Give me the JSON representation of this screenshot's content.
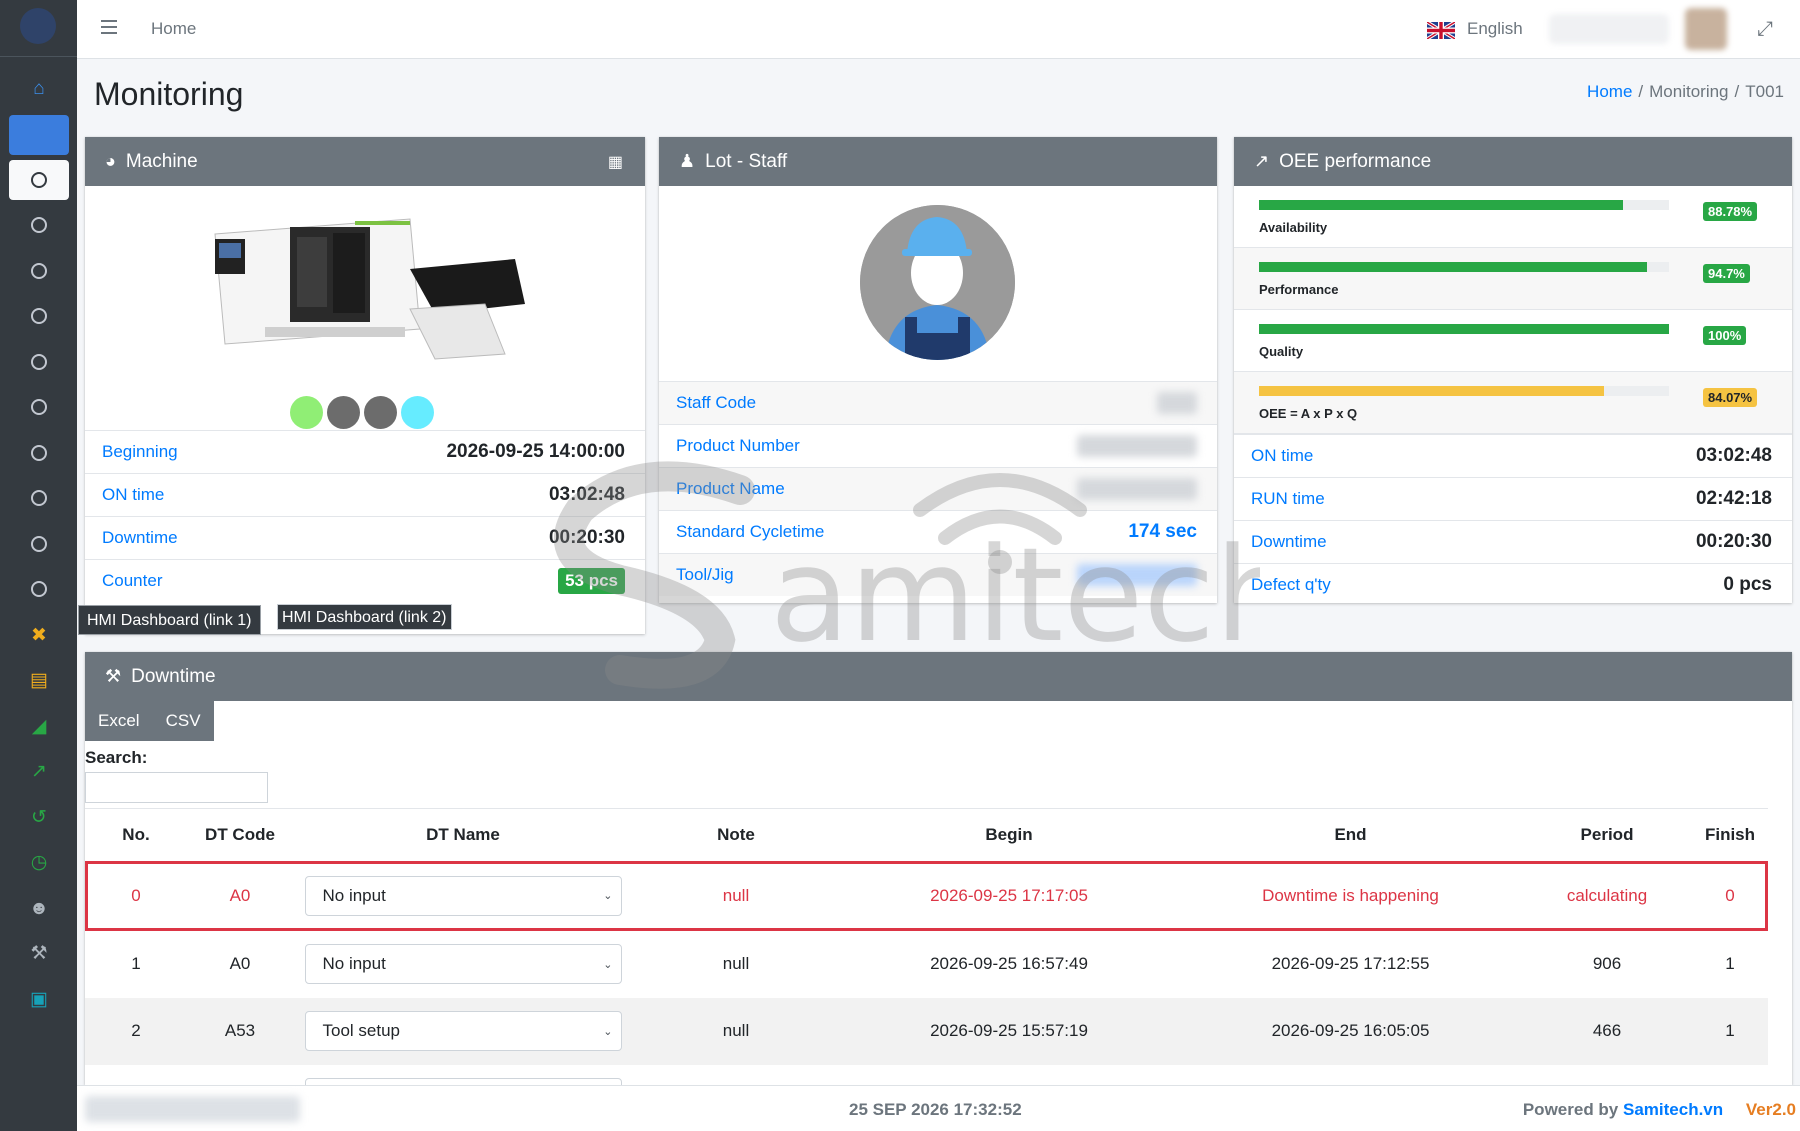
{
  "navbar": {
    "home": "Home",
    "language": "English"
  },
  "page": {
    "title": "Monitoring",
    "breadcrumb": [
      "Home",
      "Monitoring",
      "T001"
    ]
  },
  "machine": {
    "title": "Machine",
    "status_colors": [
      "#90ee75",
      "#6c6c6c",
      "#6c6c6c",
      "#66ecff"
    ],
    "rows": [
      {
        "label": "Beginning",
        "value": "2026-09-25 14:00:00"
      },
      {
        "label": "ON time",
        "value": "03:02:48"
      },
      {
        "label": "Downtime",
        "value": "00:20:30"
      },
      {
        "label": "Counter",
        "value": "53 pcs"
      }
    ],
    "link1": "HMI Dashboard (link 1)",
    "link2": "HMI Dashboard (link 2)"
  },
  "staff": {
    "title": "Lot - Staff",
    "rows": [
      {
        "label": "Staff Code"
      },
      {
        "label": "Product Number"
      },
      {
        "label": "Product Name"
      },
      {
        "label": "Standard Cycletime",
        "value": "174 sec"
      },
      {
        "label": "Tool/Jig"
      }
    ]
  },
  "oee": {
    "title": "OEE performance",
    "metrics": [
      {
        "label": "Availability",
        "percent": 88.78,
        "badge": "88.78%",
        "color": "#28a745"
      },
      {
        "label": "Performance",
        "percent": 94.7,
        "badge": "94.7%",
        "color": "#28a745"
      },
      {
        "label": "Quality",
        "percent": 100,
        "badge": "100%",
        "color": "#28a745"
      },
      {
        "label": "OEE = A x P x Q",
        "percent": 84.07,
        "badge": "84.07%",
        "color": "#f5c342"
      }
    ],
    "rows": [
      {
        "label": "ON time",
        "value": "03:02:48"
      },
      {
        "label": "RUN time",
        "value": "02:42:18"
      },
      {
        "label": "Downtime",
        "value": "00:20:30"
      },
      {
        "label": "Defect q'ty",
        "value": "0 pcs"
      }
    ]
  },
  "downtime": {
    "title": "Downtime",
    "buttons": [
      "Excel",
      "CSV"
    ],
    "search_label": "Search:",
    "columns": [
      "No.",
      "DT Code",
      "DT Name",
      "Note",
      "Begin",
      "End",
      "Period",
      "Finish"
    ],
    "rows": [
      {
        "no": "0",
        "code": "A0",
        "name": "No input",
        "note": "null",
        "begin": "2026-09-25 17:17:05",
        "end": "Downtime is happening",
        "period": "calculating",
        "finish": "0"
      },
      {
        "no": "1",
        "code": "A0",
        "name": "No input",
        "note": "null",
        "begin": "2026-09-25 16:57:49",
        "end": "2026-09-25 17:12:55",
        "period": "906",
        "finish": "1"
      },
      {
        "no": "2",
        "code": "A53",
        "name": "Tool setup",
        "note": "null",
        "begin": "2026-09-25 15:57:19",
        "end": "2026-09-25 16:05:05",
        "period": "466",
        "finish": "1"
      }
    ]
  },
  "footer": {
    "datetime": "25 SEP 2026 17:32:52",
    "powered": "Powered by",
    "brand": "Samitech.vn",
    "version": "Ver2.0"
  },
  "watermark": "amitech"
}
